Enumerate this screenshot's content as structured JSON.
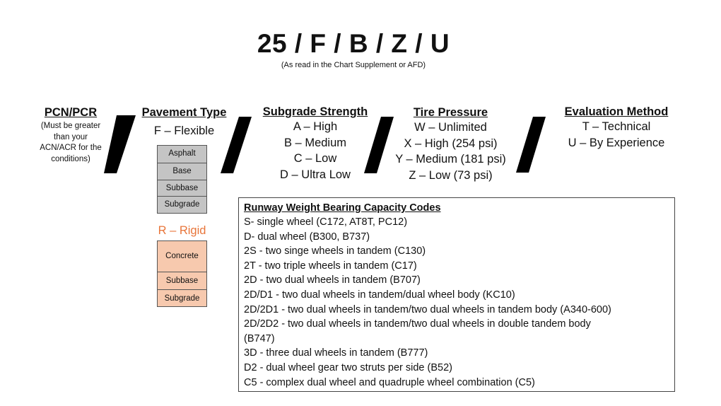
{
  "header": {
    "code": "25 / F / B / Z / U",
    "subtitle": "(As read in the Chart Supplement or AFD)"
  },
  "columns": {
    "pcn": {
      "heading": "PCN/PCR",
      "note_lines": [
        "(Must be greater",
        "than your",
        "ACN/ACR for the",
        "conditions)"
      ]
    },
    "pavement": {
      "heading": "Pavement Type",
      "flexible_label": "F – Flexible",
      "flexible_layers": [
        "Asphalt",
        "Base",
        "Subbase",
        "Subgrade"
      ],
      "rigid_label": "R – Rigid",
      "rigid_layers": [
        "Concrete",
        "Subbase",
        "Subgrade"
      ],
      "colors": {
        "flexible_fill": "#c4c4c4",
        "rigid_fill": "#f7c9ae",
        "rigid_label": "#e8753a"
      }
    },
    "subgrade": {
      "heading": "Subgrade Strength",
      "items": [
        "A – High",
        "B – Medium",
        "C – Low",
        "D – Ultra Low"
      ]
    },
    "tire": {
      "heading": "Tire Pressure",
      "items": [
        "W – Unlimited",
        "X – High (254 psi)",
        "Y – Medium (181 psi)",
        "Z – Low (73 psi)"
      ]
    },
    "evaluation": {
      "heading": "Evaluation Method",
      "items": [
        "T – Technical",
        "U – By Experience"
      ]
    }
  },
  "codes": {
    "title": "Runway Weight Bearing Capacity Codes",
    "lines": [
      "S- single wheel (C172, AT8T, PC12)",
      "D- dual wheel (B300, B737)",
      "2S - two singe wheels in tandem (C130)",
      "2T - two triple wheels in tandem (C17)",
      "2D - two dual wheels in tandem (B707)",
      "2D/D1 - two dual wheels in tandem/dual wheel body (KC10)",
      "2D/2D1 - two dual wheels in tandem/two dual wheels in tandem body (A340-600)",
      "2D/2D2 - two dual wheels in tandem/two dual wheels in double tandem body",
      "(B747)",
      "3D - three dual wheels in tandem (B777)",
      "D2 - dual wheel gear two struts per side (B52)",
      "C5 - complex dual wheel and quadruple wheel combination (C5)"
    ]
  }
}
